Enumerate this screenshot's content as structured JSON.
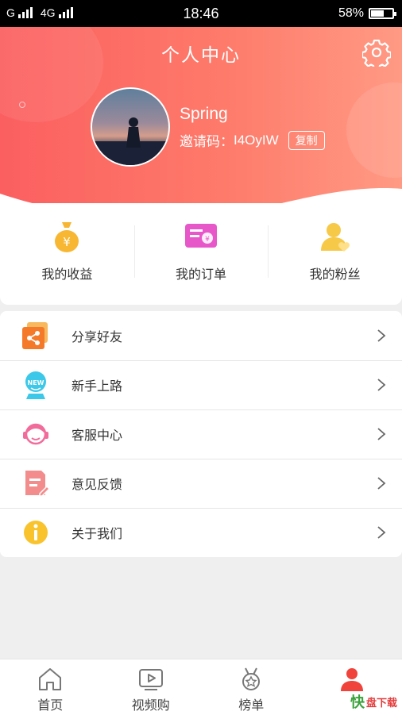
{
  "status": {
    "carrier1": "G",
    "carrier2": "4G",
    "time": "18:46",
    "battery": "58%",
    "battery_level": 0.58
  },
  "header": {
    "title": "个人中心",
    "username": "Spring",
    "invite_label": "邀请码：",
    "invite_code": "I4OyIW",
    "copy_label": "复制"
  },
  "quick": [
    {
      "label": "我的收益",
      "icon": "money-bag-icon"
    },
    {
      "label": "我的订单",
      "icon": "order-card-icon"
    },
    {
      "label": "我的粉丝",
      "icon": "fans-icon"
    }
  ],
  "menu": [
    {
      "label": "分享好友",
      "icon": "share-icon"
    },
    {
      "label": "新手上路",
      "icon": "new-robot-icon"
    },
    {
      "label": "客服中心",
      "icon": "customer-service-icon"
    },
    {
      "label": "意见反馈",
      "icon": "feedback-icon"
    },
    {
      "label": "关于我们",
      "icon": "info-icon"
    }
  ],
  "tabs": [
    {
      "label": "首页",
      "icon": "home-icon"
    },
    {
      "label": "视频购",
      "icon": "video-icon"
    },
    {
      "label": "榜单",
      "icon": "medal-icon"
    },
    {
      "label": "",
      "icon": "profile-icon",
      "active": true
    }
  ],
  "watermark": {
    "k": "快",
    "rest": "盘下载"
  },
  "colors": {
    "accent": "#fb5f60",
    "active_tab": "#f0433b"
  }
}
